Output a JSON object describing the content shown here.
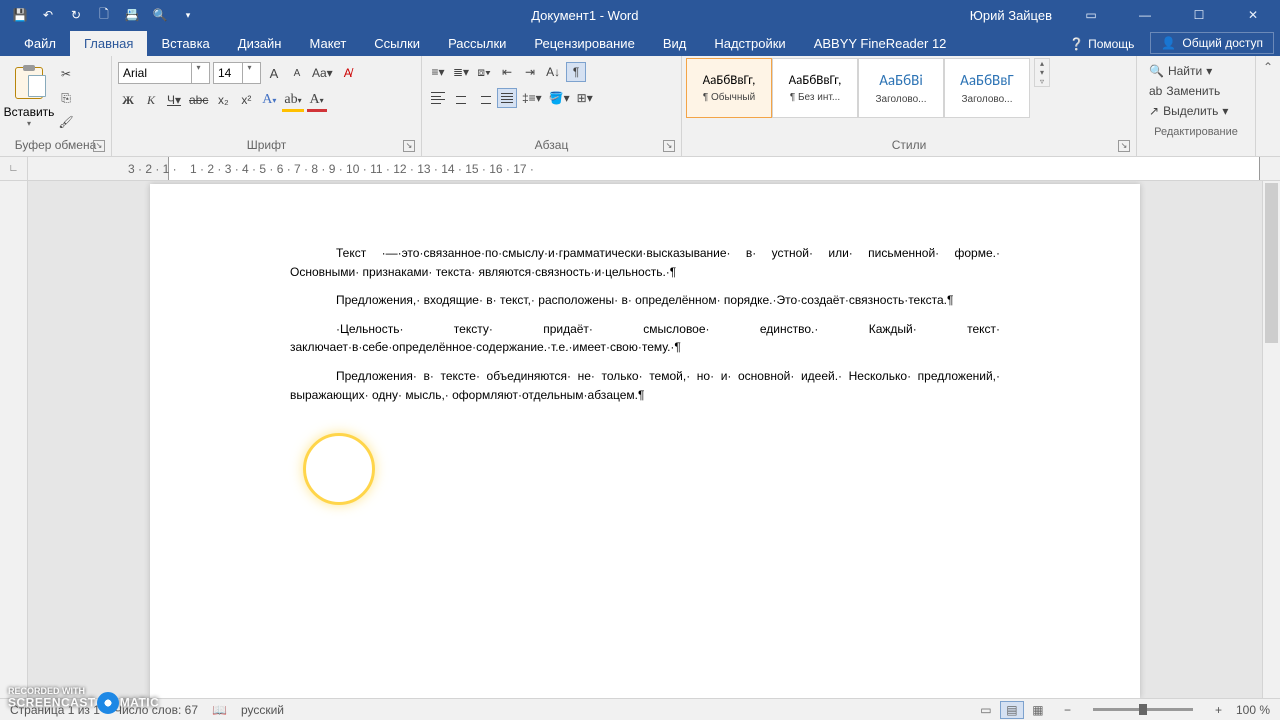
{
  "titlebar": {
    "doc_title": "Документ1 - Word",
    "user": "Юрий Зайцев"
  },
  "tabs": {
    "file": "Файл",
    "home": "Главная",
    "insert": "Вставка",
    "design": "Дизайн",
    "layout": "Макет",
    "references": "Ссылки",
    "mailings": "Рассылки",
    "review": "Рецензирование",
    "view": "Вид",
    "addins": "Надстройки",
    "abbyy": "ABBYY FineReader 12",
    "help": "Помощь",
    "share": "Общий доступ"
  },
  "ribbon": {
    "clipboard": {
      "paste": "Вставить",
      "label": "Буфер обмена"
    },
    "font": {
      "name": "Arial",
      "size": "14",
      "bold": "Ж",
      "italic": "К",
      "underline": "Ч",
      "label": "Шрифт"
    },
    "paragraph": {
      "label": "Абзац"
    },
    "styles": {
      "label": "Стили",
      "s1_preview": "АаБбВвГг,",
      "s1_name": "¶ Обычный",
      "s2_preview": "АаБбВвГг,",
      "s2_name": "¶ Без инт...",
      "s3_preview": "АаБбВі",
      "s3_name": "Заголово...",
      "s4_preview": "АаБбВвГ",
      "s4_name": "Заголово..."
    },
    "editing": {
      "find": "Найти",
      "replace": "Заменить",
      "select": "Выделить",
      "label": "Редактирование"
    }
  },
  "document": {
    "p1": "Текст ·—·это·связанное·по·смыслу·и·грамматически·высказывание· в· устной· или· письменной· форме.· Основными· признаками· текста· являются·связность·и·цельность.·¶",
    "p2": "Предложения,· входящие· в· текст,· расположены· в· определённом· порядке.·Это·создаёт·связность·текста.¶",
    "p3": "·Цельность· тексту· придаёт· смысловое· единство.· Каждый· текст· заключает·в·себе·определённое·содержание.·т.е.·имеет·свою·тему.·¶",
    "p4": "Предложения· в· тексте· объединяются· не· только· темой,· но· и· основной· идеей.· Несколько· предложений,· выражающих· одну· мысль,· оформляют·отдельным·абзацем.¶"
  },
  "statusbar": {
    "page": "Страница 1 из 1",
    "words": "Число слов: 67",
    "lang": "русский",
    "zoom": "100 %"
  },
  "watermark": {
    "line1": "RECORDED WITH",
    "brand_a": "SCREENCAST",
    "brand_b": "MATIC"
  }
}
